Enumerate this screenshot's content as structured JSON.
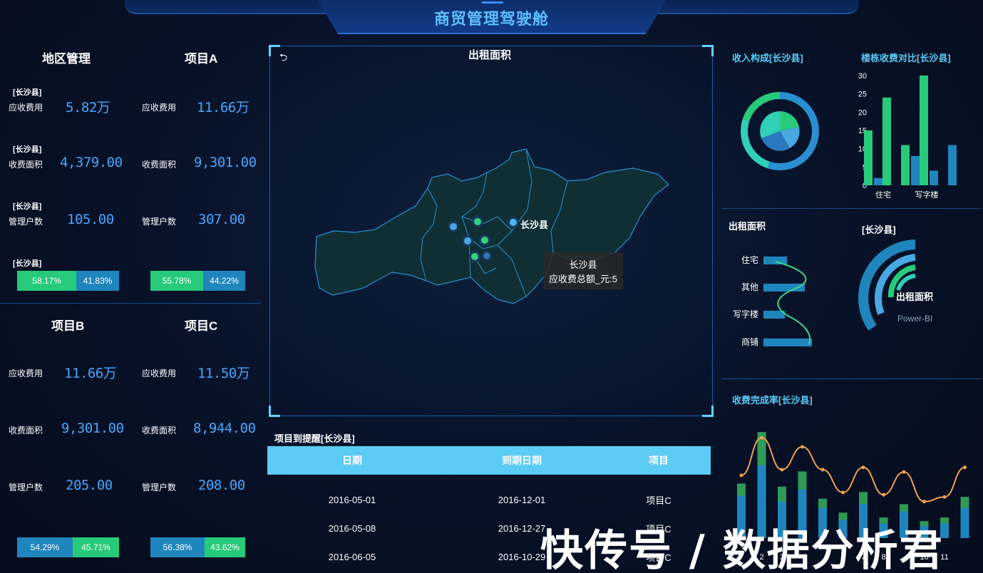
{
  "header": {
    "title": "商贸管理驾驶舱"
  },
  "left": {
    "region": {
      "title": "地区管理",
      "tag": "[长沙县]",
      "fee_label": "应收费用",
      "fee_value": "5.82万",
      "area_label": "收费面积",
      "area_value": "4,379.00",
      "hh_label": "管理户数",
      "hh_value": "105.00",
      "pct_green": "58.17%",
      "pct_blue": "41.83%"
    },
    "project_a": {
      "title": "项目A",
      "fee_label": "应收费用",
      "fee_value": "11.66万",
      "area_label": "收费面积",
      "area_value": "9,301.00",
      "hh_label": "管理户数",
      "hh_value": "307.00",
      "pct_green": "55.78%",
      "pct_blue": "44.22%"
    },
    "project_b": {
      "title": "项目B",
      "fee_label": "应收费用",
      "fee_value": "11.66万",
      "area_label": "收费面积",
      "area_value": "9,301.00",
      "hh_label": "管理户数",
      "hh_value": "205.00",
      "pct_blue": "54.29%",
      "pct_green": "45.71%"
    },
    "project_c": {
      "title": "项目C",
      "fee_label": "应收费用",
      "fee_value": "11.50万",
      "area_label": "收费面积",
      "area_value": "8,944.00",
      "hh_label": "管理户数",
      "hh_value": "208.00",
      "pct_blue": "56.38%",
      "pct_green": "43.62%"
    }
  },
  "map": {
    "title": "出租面积",
    "back_icon": "return-icon",
    "city_label": "长沙县",
    "tooltip_line1": "长沙县",
    "tooltip_line2": "应收费总额_元:5"
  },
  "table": {
    "title": "项目到提醒[长沙县]",
    "headers": [
      "日期",
      "到期日期",
      "项目"
    ],
    "rows": [
      [
        "2016-05-01",
        "2016-12-01",
        "项目C"
      ],
      [
        "2016-05-08",
        "2016-12-27",
        "项目C"
      ],
      [
        "2016-06-05",
        "2016-10-29",
        "项目C"
      ]
    ]
  },
  "right": {
    "income_title": "收入构成[长沙县]",
    "building_title": "楼栋收费对比[长沙县]",
    "rent_title": "出租面积",
    "rent_tag": "[长沙县]",
    "gauge_label": "出租面积",
    "gauge_sub": "Power-BI",
    "completion_title": "收费完成率[长沙县]"
  },
  "chart_data": [
    {
      "type": "pie",
      "title": "收入构成[长沙县]",
      "outer_ring": [
        0.55,
        0.25,
        0.2
      ],
      "inner_pie": [
        0.3,
        0.25,
        0.25,
        0.2
      ]
    },
    {
      "type": "bar",
      "title": "楼栋收费对比[长沙县]",
      "categories": [
        "住宅",
        "",
        "写字楼",
        "",
        ""
      ],
      "ylim": [
        0,
        30
      ],
      "yticks": [
        0,
        5,
        10,
        15,
        20,
        25,
        30
      ],
      "xtick_labels": [
        "住宅",
        "写字楼"
      ],
      "series": [
        {
          "values": [
            15,
            24,
            11,
            30,
            0
          ]
        },
        {
          "values": [
            2,
            0,
            8,
            4,
            11
          ]
        }
      ]
    },
    {
      "type": "bar",
      "title": "出租面积",
      "categories": [
        "住宅",
        "其他",
        "写字楼",
        "商铺"
      ],
      "values": [
        15,
        40,
        12,
        50
      ]
    },
    {
      "type": "bar",
      "title": "收费完成率[长沙县]",
      "categories": [
        "1",
        "2",
        "3",
        "4",
        "5",
        "6",
        "7",
        "8",
        "9",
        "10",
        "11",
        "12"
      ],
      "xtick_labels": [
        "2",
        "3",
        "6",
        "7",
        "8",
        "10",
        "11"
      ],
      "series": [
        {
          "values": [
            35,
            60,
            30,
            40,
            25,
            15,
            28,
            12,
            22,
            10,
            12,
            25
          ]
        },
        {
          "values": [
            20,
            55,
            25,
            30,
            15,
            12,
            20,
            10,
            12,
            8,
            10,
            18
          ]
        }
      ],
      "line": [
        55,
        88,
        60,
        80,
        60,
        40,
        62,
        38,
        58,
        32,
        36,
        62
      ]
    }
  ]
}
